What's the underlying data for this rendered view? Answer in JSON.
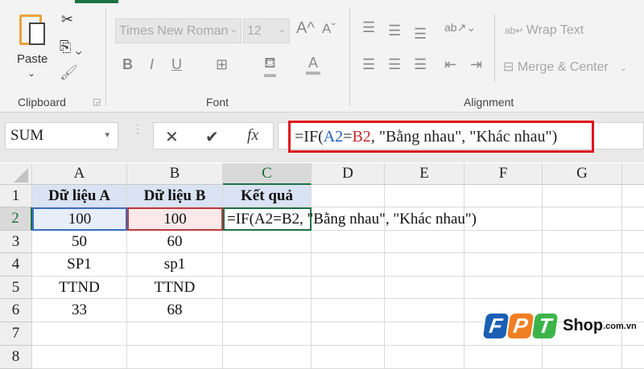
{
  "ribbon": {
    "clipboard": {
      "paste": "Paste",
      "group": "Clipboard"
    },
    "font": {
      "name": "Times New Roman",
      "size": "12",
      "bold": "B",
      "italic": "I",
      "underline": "U",
      "font_color": "A",
      "grow": "A^",
      "shrink": "Aˇ",
      "group": "Font"
    },
    "alignment": {
      "wrap": "Wrap Text",
      "merge": "Merge & Center",
      "group": "Alignment"
    }
  },
  "formula_bar": {
    "name_box": "SUM",
    "cancel": "✕",
    "enter": "✔",
    "fx": "fx",
    "formula_parts": [
      "=IF(",
      "A2",
      "=",
      "B2",
      ", \"Bằng nhau\", \"Khác nhau\")"
    ]
  },
  "sheet": {
    "columns": [
      "A",
      "B",
      "C",
      "D",
      "E",
      "F",
      "G"
    ],
    "rows": [
      "1",
      "2",
      "3",
      "4",
      "5",
      "6",
      "7",
      "8"
    ],
    "cells": [
      [
        "Dữ liệu A",
        "Dữ liệu B",
        "Kết quả"
      ],
      [
        "100",
        "100",
        "=IF(A2=B2, \"Bằng nhau\", \"Khác nhau\")"
      ],
      [
        "50",
        "60",
        ""
      ],
      [
        "SP1",
        "sp1",
        ""
      ],
      [
        "TTND",
        "TTND",
        ""
      ],
      [
        "33",
        "68",
        ""
      ],
      [
        "",
        "",
        ""
      ],
      [
        "",
        "",
        ""
      ]
    ],
    "active_cell": "C2"
  },
  "watermark": {
    "brand": "FPT",
    "text": "Shop",
    "domain": ".com.vn"
  }
}
